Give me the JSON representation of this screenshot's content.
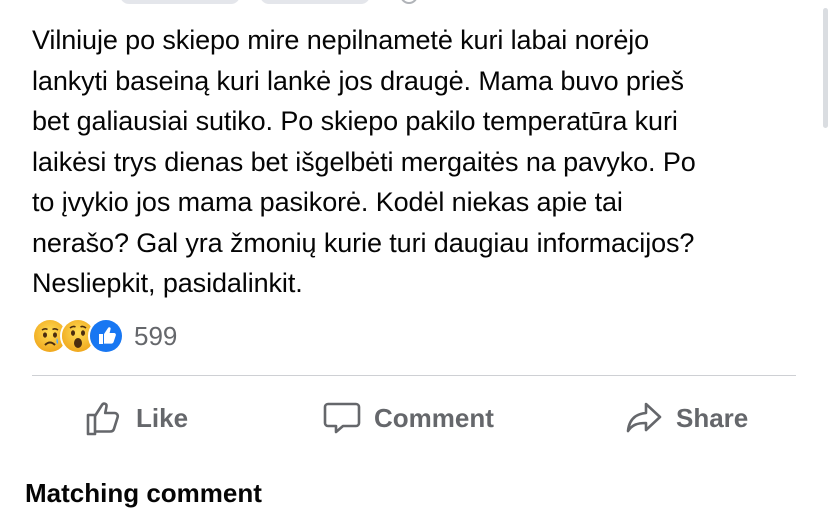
{
  "post": {
    "text": "Vilniuje po skiepo mire nepilnametė kuri labai norėjo lankyti baseiną kuri lankė jos draugė. Mama buvo prieš bet galiausiai sutiko. Po skiepo pakilo temperatūra kuri laikėsi trys dienas bet išgelbėti mergaitės na pavyko. Po to įvykio jos mama pasikorė. Kodėl niekas apie tai nerašo? Gal yra žmonių kurie turi daugiau informacijos? Nesliepkit, pasidalinkit.",
    "lines": [
      "Vilniuje po skiepo mire nepilnametė kuri labai norėjo",
      "lankyti baseiną kuri lankė jos draugė. Mama buvo prieš",
      "bet galiausiai sutiko. Po skiepo pakilo temperatūra kuri",
      "laikėsi trys dienas bet išgelbėti mergaitės na pavyko. Po",
      "to įvykio jos mama pasikorė. Kodėl niekas apie tai",
      "nerašo? Gal yra žmonių kurie turi daugiau informacijos?",
      "Nesliepkit, pasidalinkit."
    ]
  },
  "reactions": {
    "icons": [
      "sad-reaction-icon",
      "wow-reaction-icon",
      "like-reaction-icon"
    ],
    "count": "599"
  },
  "actions": {
    "like": "Like",
    "comment": "Comment",
    "share": "Share"
  },
  "comments": {
    "heading": "Matching comment"
  },
  "colors": {
    "text": "#050505",
    "secondary": "#65676b",
    "divider": "#ced0d4",
    "like_blue": "#1877f2",
    "reaction_yellow": "#f7b125"
  }
}
